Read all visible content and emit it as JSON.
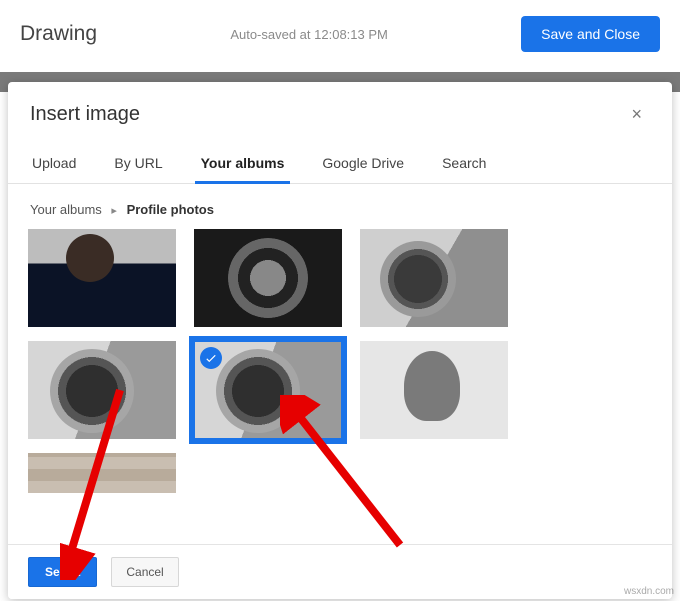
{
  "header": {
    "title": "Drawing",
    "autosave": "Auto-saved at 12:08:13 PM",
    "save_close": "Save and Close"
  },
  "modal": {
    "title": "Insert image",
    "tabs": {
      "upload": "Upload",
      "by_url": "By URL",
      "your_albums": "Your albums",
      "google_drive": "Google Drive",
      "search": "Search"
    },
    "breadcrumb": {
      "root": "Your albums",
      "current": "Profile photos"
    },
    "buttons": {
      "select": "Select",
      "cancel": "Cancel"
    }
  },
  "watermark": "wsxdn.com"
}
